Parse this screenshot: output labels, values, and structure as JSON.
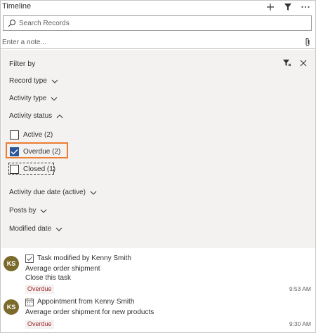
{
  "header": {
    "title": "Timeline",
    "icons": [
      "add-icon",
      "filter-icon",
      "more-icon"
    ]
  },
  "search": {
    "placeholder": "Search Records"
  },
  "note": {
    "placeholder": "Enter a note..."
  },
  "filter": {
    "title": "Filter by",
    "sections": {
      "record_type": "Record type",
      "activity_type": "Activity type",
      "activity_status": "Activity status",
      "activity_due_date": "Activity due date (active)",
      "posts_by": "Posts by",
      "modified_date": "Modified date"
    },
    "options": [
      {
        "label": "Active (2)",
        "checked": false
      },
      {
        "label": "Overdue (2)",
        "checked": true
      },
      {
        "label": "Closed (1)",
        "checked": false
      }
    ],
    "colors": {
      "checked": "#2b579a",
      "highlight": "#ed7d31"
    }
  },
  "activities": [
    {
      "avatar": "KS",
      "icon": "task-checkbox-icon",
      "title": "Task modified by Kenny Smith",
      "line1": "Average order shipment",
      "line2": "Close this task",
      "badge": "Overdue",
      "time": "9:53 AM"
    },
    {
      "avatar": "KS",
      "icon": "calendar-icon",
      "title": "Appointment from Kenny Smith",
      "line1": "Average order shipment for new products",
      "badge": "Overdue",
      "time": "9:30 AM"
    }
  ]
}
